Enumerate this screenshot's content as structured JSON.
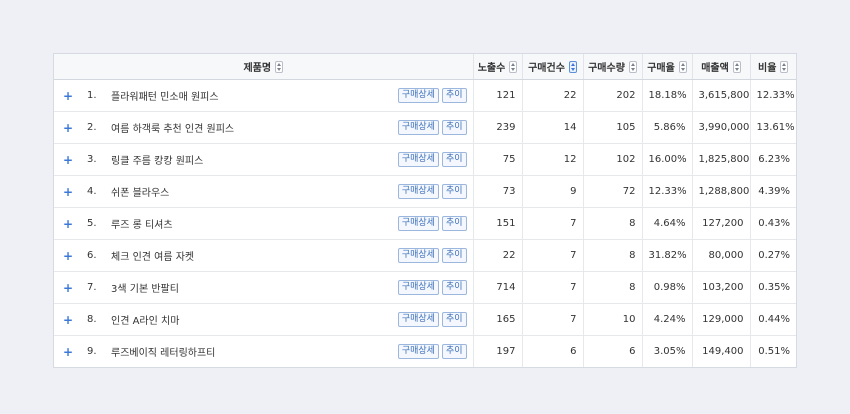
{
  "table": {
    "headers": {
      "product": "제품명",
      "views": "노출수",
      "orders": "구매건수",
      "quantity": "구매수량",
      "rate": "구매율",
      "sales": "매출액",
      "ratio": "비율"
    },
    "active_sort_column": "orders",
    "row_buttons": {
      "detail": "구매상세",
      "trend": "추이"
    },
    "expand_icon_label": "+",
    "rows": [
      {
        "num": "1.",
        "name": "플라워패턴 민소매 원피스",
        "views": "121",
        "orders": "22",
        "quantity": "202",
        "rate": "18.18%",
        "sales": "3,615,800",
        "ratio": "12.33%"
      },
      {
        "num": "2.",
        "name": "여름 하객룩 추천 인견 원피스",
        "views": "239",
        "orders": "14",
        "quantity": "105",
        "rate": "5.86%",
        "sales": "3,990,000",
        "ratio": "13.61%"
      },
      {
        "num": "3.",
        "name": "링클 주름 캉캉 원피스",
        "views": "75",
        "orders": "12",
        "quantity": "102",
        "rate": "16.00%",
        "sales": "1,825,800",
        "ratio": "6.23%"
      },
      {
        "num": "4.",
        "name": "쉬폰 블라우스",
        "views": "73",
        "orders": "9",
        "quantity": "72",
        "rate": "12.33%",
        "sales": "1,288,800",
        "ratio": "4.39%"
      },
      {
        "num": "5.",
        "name": "루즈 롱 티셔츠",
        "views": "151",
        "orders": "7",
        "quantity": "8",
        "rate": "4.64%",
        "sales": "127,200",
        "ratio": "0.43%"
      },
      {
        "num": "6.",
        "name": "체크 인견 여름 자켓",
        "views": "22",
        "orders": "7",
        "quantity": "8",
        "rate": "31.82%",
        "sales": "80,000",
        "ratio": "0.27%"
      },
      {
        "num": "7.",
        "name": "3색 기본 반팔티",
        "views": "714",
        "orders": "7",
        "quantity": "8",
        "rate": "0.98%",
        "sales": "103,200",
        "ratio": "0.35%"
      },
      {
        "num": "8.",
        "name": "인견 A라인 치마",
        "views": "165",
        "orders": "7",
        "quantity": "10",
        "rate": "4.24%",
        "sales": "129,000",
        "ratio": "0.44%"
      },
      {
        "num": "9.",
        "name": "루즈베이직 레터링하프티",
        "views": "197",
        "orders": "6",
        "quantity": "6",
        "rate": "3.05%",
        "sales": "149,400",
        "ratio": "0.51%"
      }
    ]
  },
  "colors": {
    "accent": "#3c78d8",
    "background": "#eef0f5"
  }
}
